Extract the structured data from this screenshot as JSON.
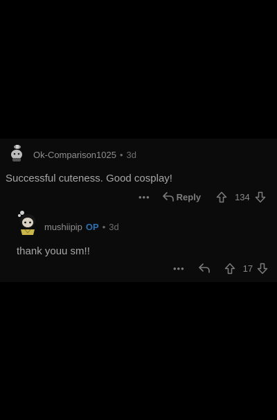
{
  "comments": [
    {
      "author": "Ok-Comparison1025",
      "separator": "•",
      "age": "3d",
      "text": "Successful cuteness. Good cosplay!",
      "more": "•••",
      "reply_label": "Reply",
      "score": "134"
    },
    {
      "author": "mushiipip",
      "op_badge": "OP",
      "separator": "•",
      "age": "3d",
      "text": "thank youu sm!!",
      "more": "•••",
      "score": "17"
    }
  ],
  "colors": {
    "background": "#000000",
    "thread_background": "#0b0b0b",
    "op_badge": "#2f6fb3",
    "text": "#a7a7a7",
    "muted": "#7d7d7d"
  },
  "icons": [
    "avatar",
    "reply-arrow-icon",
    "upvote-icon",
    "downvote-icon",
    "more-icon"
  ]
}
